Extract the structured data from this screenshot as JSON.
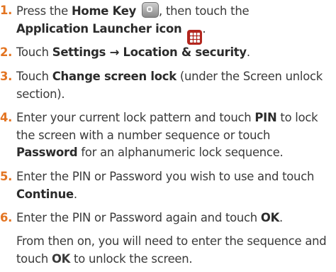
{
  "steps": [
    {
      "num": "1.",
      "line1_pre": "Press the ",
      "home_key": "Home Key",
      "line1_post": ", then touch the",
      "app_launcher": "Application Launcher icon",
      "line2_post": "."
    },
    {
      "num": "2.",
      "pre": "Touch ",
      "settings": "Settings → Location & security",
      "post": "."
    },
    {
      "num": "3.",
      "pre": "Touch ",
      "change_lock": "Change screen lock",
      "post": " (under the Screen unlock section)."
    },
    {
      "num": "4.",
      "pre": "Enter your current lock pattern and touch ",
      "pin": "PIN",
      "mid": " to lock the screen with a number sequence or touch ",
      "password": "Password",
      "post": " for an alphanumeric lock sequence."
    },
    {
      "num": "5.",
      "pre": "Enter the PIN or Password you wish to use and touch ",
      "continue": "Continue",
      "post": "."
    },
    {
      "num": "6.",
      "pre": "Enter the PIN or Password again and touch ",
      "ok": "OK",
      "post": "."
    }
  ],
  "note": {
    "pre": "From then on, you will need to enter the sequence and touch ",
    "ok": "OK",
    "post": " to unlock the screen."
  },
  "icons": {
    "home_key_icon": "home-key-icon",
    "launcher_icon": "application-launcher-icon",
    "launcher_color": "#b3261e"
  },
  "colors": {
    "step_number": "#e37421",
    "text": "#3a3a3a"
  }
}
